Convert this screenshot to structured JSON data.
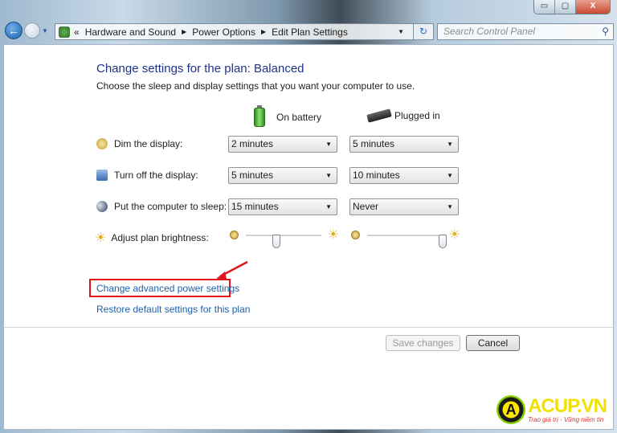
{
  "window": {
    "minimize": "▭",
    "maximize": "▢",
    "close": "X"
  },
  "address": {
    "overflow": "«",
    "crumbs": [
      "Hardware and Sound",
      "Power Options",
      "Edit Plan Settings"
    ]
  },
  "search": {
    "placeholder": "Search Control Panel"
  },
  "main": {
    "title": "Change settings for the plan: Balanced",
    "subtitle": "Choose the sleep and display settings that you want your computer to use.",
    "columns": {
      "battery": "On battery",
      "plugged": "Plugged in"
    },
    "rows": [
      {
        "label": "Dim the display:",
        "battery": "2 minutes",
        "plugged": "5 minutes"
      },
      {
        "label": "Turn off the display:",
        "battery": "5 minutes",
        "plugged": "10 minutes"
      },
      {
        "label": "Put the computer to sleep:",
        "battery": "15 minutes",
        "plugged": "Never"
      }
    ],
    "brightness": {
      "label": "Adjust plan brightness:",
      "battery_percent": 40,
      "plugged_percent": 100
    },
    "links": {
      "advanced": "Change advanced power settings",
      "restore": "Restore default settings for this plan"
    },
    "buttons": {
      "save": "Save changes",
      "cancel": "Cancel"
    }
  },
  "annotation": {
    "highlight_color": "#e0161c"
  },
  "watermark": {
    "brand": "ACUP.VN",
    "tagline": "Trao giá trị - Vững niềm tin"
  }
}
